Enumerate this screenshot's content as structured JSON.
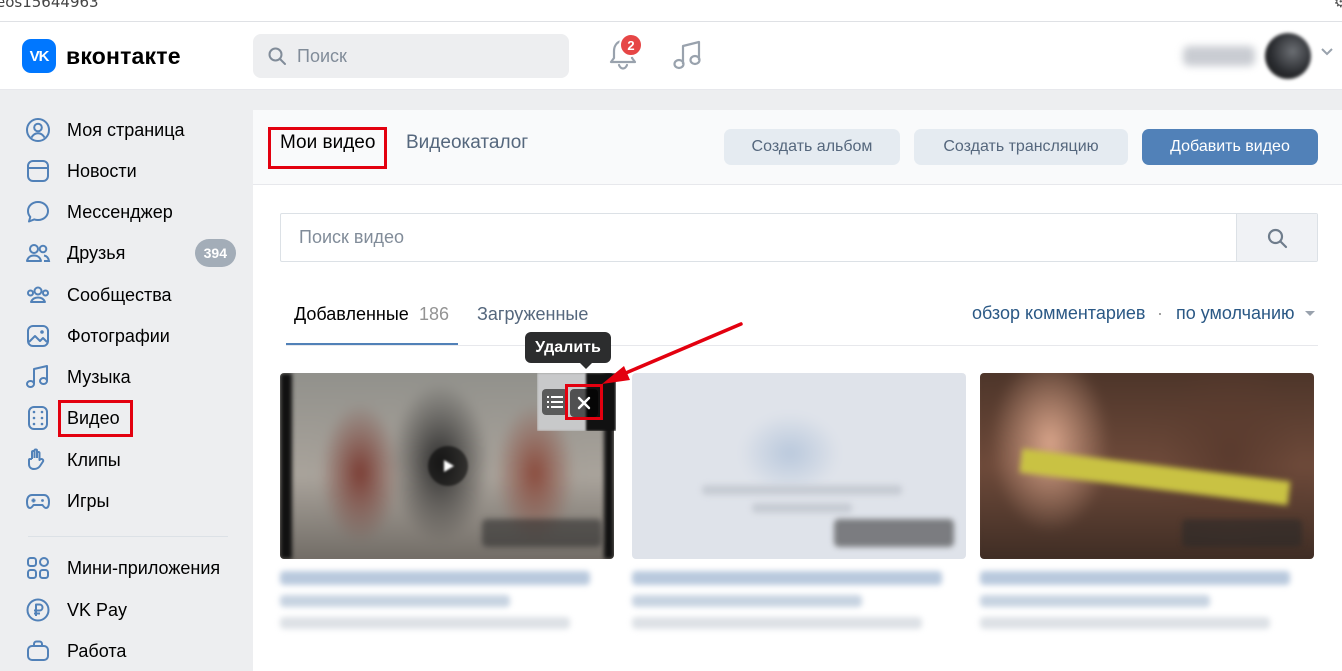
{
  "browser": {
    "url_fragment": "eos15644963"
  },
  "header": {
    "logo_mark": "VK",
    "logo_text": "вконтакте",
    "search_placeholder": "Поиск",
    "notifications_count": "2"
  },
  "sidebar": {
    "items": [
      {
        "label": "Моя страница",
        "icon": "user-circle-icon"
      },
      {
        "label": "Новости",
        "icon": "news-icon"
      },
      {
        "label": "Мессенджер",
        "icon": "message-icon"
      },
      {
        "label": "Друзья",
        "icon": "friends-icon",
        "count": "394"
      },
      {
        "label": "Сообщества",
        "icon": "communities-icon"
      },
      {
        "label": "Фотографии",
        "icon": "photo-icon"
      },
      {
        "label": "Музыка",
        "icon": "music-icon"
      },
      {
        "label": "Видео",
        "icon": "video-icon"
      },
      {
        "label": "Клипы",
        "icon": "clips-icon"
      },
      {
        "label": "Игры",
        "icon": "gamepad-icon"
      },
      {
        "label": "Мини-приложения",
        "icon": "apps-icon"
      },
      {
        "label": "VK Pay",
        "icon": "vkpay-icon"
      },
      {
        "label": "Работа",
        "icon": "briefcase-icon"
      }
    ]
  },
  "main": {
    "tabs": [
      {
        "label": "Мои видео"
      },
      {
        "label": "Видеокаталог"
      }
    ],
    "buttons": {
      "create_album": "Создать альбом",
      "create_stream": "Создать трансляцию",
      "add_video": "Добавить видео"
    },
    "video_search_placeholder": "Поиск видео",
    "subtabs": {
      "added_label": "Добавленные",
      "added_count": "186",
      "uploaded_label": "Загруженные"
    },
    "sort": {
      "comments": "обзор комментариев",
      "separator": "·",
      "default": "по умолчанию"
    },
    "tooltip": "Удалить"
  },
  "colors": {
    "accent": "#5181b8",
    "brand": "#0077ff",
    "highlight": "#e3000f",
    "badge": "#e64646"
  }
}
